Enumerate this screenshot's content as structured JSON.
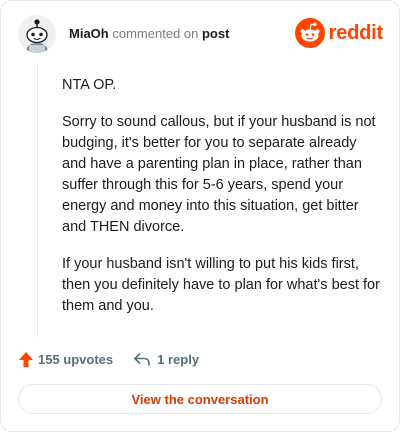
{
  "header": {
    "username": "MiaOh",
    "action_text": "commented on",
    "post_link": "post",
    "brand": "reddit"
  },
  "icons": {
    "avatar": "snoo-avatar-icon",
    "logo": "reddit-snoo-icon",
    "upvote": "upvote-arrow-icon",
    "reply": "reply-arrow-icon"
  },
  "colors": {
    "brand": "#ff4500",
    "upvote_active": "#ff4500",
    "cta_text": "#d93a00",
    "muted": "#576f76"
  },
  "comment": {
    "paragraphs": [
      "NTA OP.",
      "Sorry to sound callous, but if your husband is not budging, it's better for you to separate already and have a parenting plan in place, rather than suffer through this for 5-6 years, spend your energy and money into this situation, get bitter and THEN divorce.",
      "If your husband isn't willing to put his kids first, then you definitely have to plan for what's best for them and you."
    ]
  },
  "actions": {
    "upvotes": "155 upvotes",
    "replies": "1 reply"
  },
  "cta": {
    "label": "View the conversation"
  }
}
